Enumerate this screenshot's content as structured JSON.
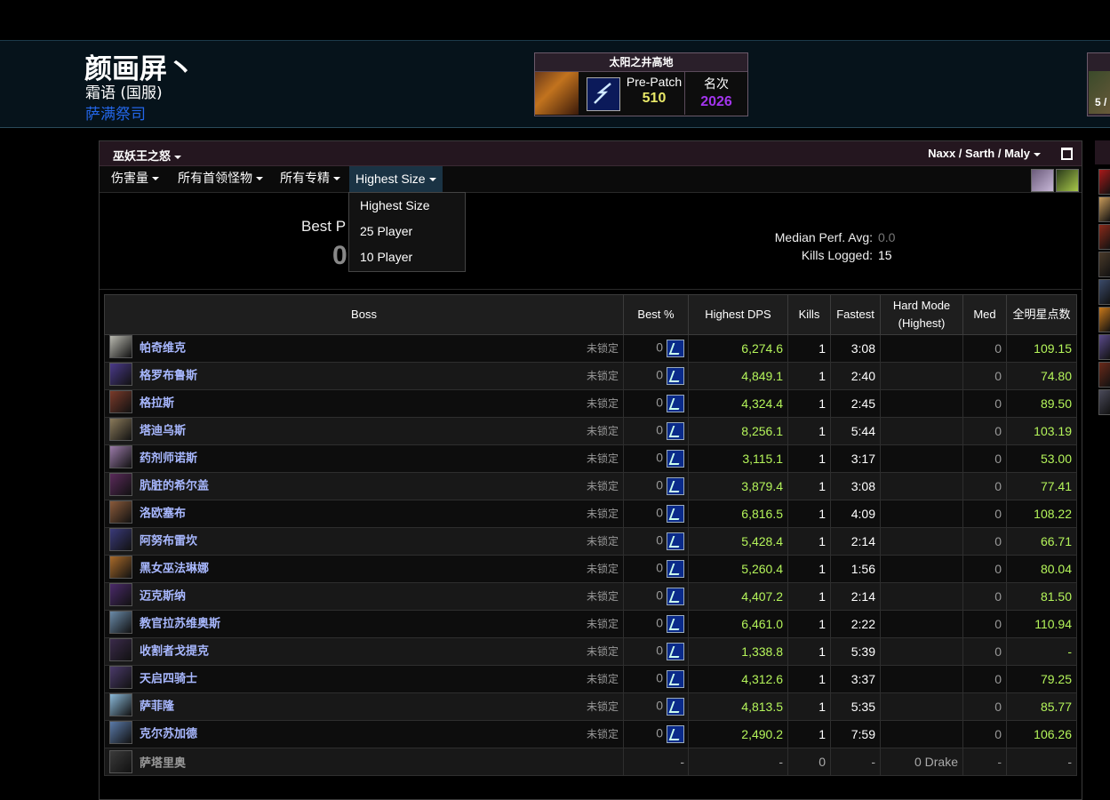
{
  "character": {
    "name": "颜画屏丶",
    "server": "霜语 (国服)",
    "class": "萨满祭司",
    "class_color": "#2366e8"
  },
  "zone_box": {
    "title": "太阳之井高地",
    "phase_label": "Pre-Patch",
    "phase_value": "510",
    "rank_label": "名次",
    "rank_value": "2026"
  },
  "zone_box2": {
    "text": "5 /"
  },
  "panel": {
    "zone_name": "巫妖王之怒",
    "partition": "Naxx / Sarth / Maly"
  },
  "filters": {
    "metric": "伤害量",
    "bosses": "所有首领怪物",
    "specs": "所有专精",
    "size": "Highest Size"
  },
  "dropdown": {
    "options": [
      "Highest Size",
      "25 Player",
      "10 Player"
    ]
  },
  "summary": {
    "best_perf_label": "Best P",
    "best_perf_value": "0",
    "median_label": "Median Perf. Avg:",
    "median_value": "0.0",
    "kills_label": "Kills Logged:",
    "kills_value": "15"
  },
  "table": {
    "headers": {
      "boss": "Boss",
      "best": "Best %",
      "dps": "Highest DPS",
      "kills": "Kills",
      "fastest": "Fastest",
      "hardmode_1": "Hard Mode",
      "hardmode_2": "(Highest)",
      "med": "Med",
      "stars": "全明星点数"
    },
    "locked_label": "未锁定",
    "rows": [
      {
        "name": "帕奇维克",
        "best": "0",
        "dps": "6,274.6",
        "kills": "1",
        "fastest": "3:08",
        "hm": "",
        "med": "0",
        "stars": "109.15",
        "color": "#b9b9b0"
      },
      {
        "name": "格罗布鲁斯",
        "best": "0",
        "dps": "4,849.1",
        "kills": "1",
        "fastest": "2:40",
        "hm": "",
        "med": "0",
        "stars": "74.80",
        "color": "#4a3a8a"
      },
      {
        "name": "格拉斯",
        "best": "0",
        "dps": "4,324.4",
        "kills": "1",
        "fastest": "2:45",
        "hm": "",
        "med": "0",
        "stars": "89.50",
        "color": "#7a3a2a"
      },
      {
        "name": "塔迪乌斯",
        "best": "0",
        "dps": "8,256.1",
        "kills": "1",
        "fastest": "5:44",
        "hm": "",
        "med": "0",
        "stars": "103.19",
        "color": "#8a7a5a"
      },
      {
        "name": "药剂师诺斯",
        "best": "0",
        "dps": "3,115.1",
        "kills": "1",
        "fastest": "3:17",
        "hm": "",
        "med": "0",
        "stars": "53.00",
        "color": "#9a7aa8"
      },
      {
        "name": "肮脏的希尔盖",
        "best": "0",
        "dps": "3,879.4",
        "kills": "1",
        "fastest": "3:08",
        "hm": "",
        "med": "0",
        "stars": "77.41",
        "color": "#5a2a5a"
      },
      {
        "name": "洛欧塞布",
        "best": "0",
        "dps": "6,816.5",
        "kills": "1",
        "fastest": "4:09",
        "hm": "",
        "med": "0",
        "stars": "108.22",
        "color": "#8a5a3a"
      },
      {
        "name": "阿努布雷坎",
        "best": "0",
        "dps": "5,428.4",
        "kills": "1",
        "fastest": "2:14",
        "hm": "",
        "med": "0",
        "stars": "66.71",
        "color": "#3a3a7a"
      },
      {
        "name": "黑女巫法琳娜",
        "best": "0",
        "dps": "5,260.4",
        "kills": "1",
        "fastest": "1:56",
        "hm": "",
        "med": "0",
        "stars": "80.04",
        "color": "#a86a2a"
      },
      {
        "name": "迈克斯纳",
        "best": "0",
        "dps": "4,407.2",
        "kills": "1",
        "fastest": "2:14",
        "hm": "",
        "med": "0",
        "stars": "81.50",
        "color": "#4a2a6a"
      },
      {
        "name": "教官拉苏维奥斯",
        "best": "0",
        "dps": "6,461.0",
        "kills": "1",
        "fastest": "2:22",
        "hm": "",
        "med": "0",
        "stars": "110.94",
        "color": "#6a8aa8"
      },
      {
        "name": "收割者戈提克",
        "best": "0",
        "dps": "1,338.8",
        "kills": "1",
        "fastest": "5:39",
        "hm": "",
        "med": "0",
        "stars": "-",
        "color": "#3a2a4a"
      },
      {
        "name": "天启四骑士",
        "best": "0",
        "dps": "4,312.6",
        "kills": "1",
        "fastest": "3:37",
        "hm": "",
        "med": "0",
        "stars": "79.25",
        "color": "#4a3a6a"
      },
      {
        "name": "萨菲隆",
        "best": "0",
        "dps": "4,813.5",
        "kills": "1",
        "fastest": "5:35",
        "hm": "",
        "med": "0",
        "stars": "85.77",
        "color": "#8ab8d8"
      },
      {
        "name": "克尔苏加德",
        "best": "0",
        "dps": "2,490.2",
        "kills": "1",
        "fastest": "7:59",
        "hm": "",
        "med": "0",
        "stars": "106.26",
        "color": "#5a7aa8"
      },
      {
        "name": "萨塔里奥",
        "best": "-",
        "dps": "-",
        "kills": "0",
        "fastest": "-",
        "hm": "0 Drake",
        "med": "-",
        "stars": "-",
        "color": "#3a3a3a",
        "dim": true
      }
    ]
  }
}
